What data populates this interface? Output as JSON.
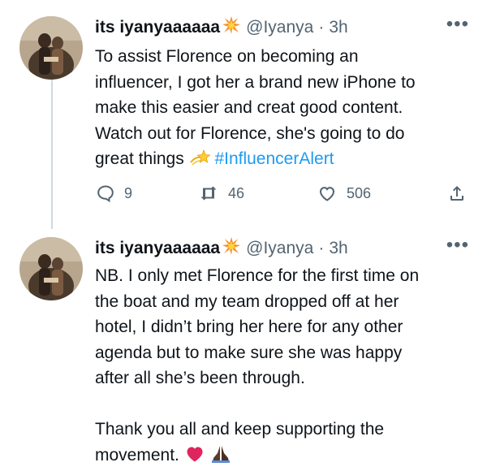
{
  "tweets": [
    {
      "display_name": "its iyanyaaaaaa",
      "handle": "@Iyanya",
      "separator": "·",
      "time": "3h",
      "text_lines": [
        "To assist Florence on becoming an",
        "influencer, I got her a brand new iPhone to",
        "make this easier and creat good content.",
        "Watch out for Florence, she's going to do",
        "great things"
      ],
      "hashtag": "#InfluencerAlert",
      "emoji_icon": "dizzy-star-icon",
      "actions": {
        "replies": "9",
        "retweets": "46",
        "likes": "506"
      }
    },
    {
      "display_name": "its iyanyaaaaaa",
      "handle": "@Iyanya",
      "separator": "·",
      "time": "3h",
      "text_lines": [
        "NB. I only met Florence for the first time on",
        "the boat and my team dropped off at her",
        "hotel, I didn’t bring her here for any other",
        "agenda but to make sure she was happy",
        "after all she’s been through."
      ],
      "text_lines_2": [
        "Thank you all and keep supporting the",
        "movement."
      ],
      "end_emojis": [
        "red-heart-icon",
        "praying-hands-icon"
      ]
    }
  ],
  "colors": {
    "text": "#0f1419",
    "secondary": "#536471",
    "link": "#1d9bf0",
    "thread_line": "#cfd9de",
    "heart": "#e0245e"
  }
}
